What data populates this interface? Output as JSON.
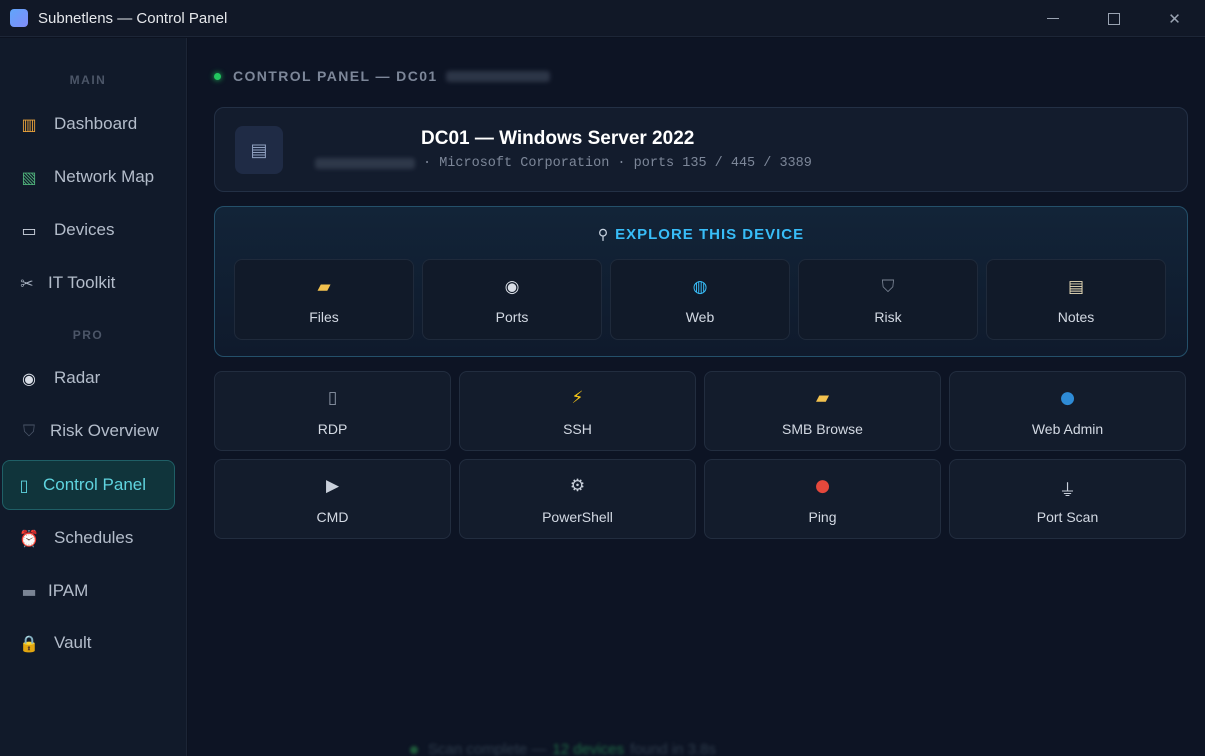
{
  "window": {
    "title": "Subnetlens — Control Panel",
    "controls": {
      "minimize": "minimize",
      "maximize": "maximize",
      "close": "✕"
    }
  },
  "sidebar": {
    "sections": [
      {
        "label": "MAIN"
      },
      {
        "label": "PRO"
      }
    ],
    "items": [
      {
        "label": "Dashboard",
        "icon": "chart-icon",
        "glyph": "▥",
        "color": "#e9a23b"
      },
      {
        "label": "Network Map",
        "icon": "map-icon",
        "glyph": "▧",
        "color": "#4fb07a"
      },
      {
        "label": "Devices",
        "icon": "laptop-icon",
        "glyph": "▭",
        "color": "#cfd6e0"
      },
      {
        "label": "IT Toolkit",
        "icon": "tools-icon",
        "glyph": "✂",
        "color": "#a9b3c2"
      },
      {
        "label": "Radar",
        "icon": "satellite-dish-icon",
        "glyph": "◉",
        "color": "#d9dee6"
      },
      {
        "label": "Risk Overview",
        "icon": "shield-icon",
        "glyph": "⛉",
        "color": "#4a5568"
      },
      {
        "label": "Control Panel",
        "icon": "mobile-icon",
        "glyph": "▯",
        "color": "#5fd4df",
        "active": true
      },
      {
        "label": "Schedules",
        "icon": "alarm-clock-icon",
        "glyph": "⏰",
        "color": "#e25555"
      },
      {
        "label": "IPAM",
        "icon": "server-rack-icon",
        "glyph": "▬",
        "color": "#7a8494"
      },
      {
        "label": "Vault",
        "icon": "lock-icon",
        "glyph": "🔒",
        "color": "#e8b93a"
      }
    ]
  },
  "breadcrumb": {
    "text": "CONTROL PANEL — DC01"
  },
  "device": {
    "title": "DC01 — Windows Server 2022",
    "subtitle": "· Microsoft Corporation · ports 135 / 445 / 3389",
    "icon": "server-icon"
  },
  "explore": {
    "title": "EXPLORE THIS DEVICE",
    "title_icon": "magnifier-icon",
    "tiles": [
      {
        "label": "Files",
        "icon": "folder-icon",
        "glyph": "▰",
        "color": "#f2c14e"
      },
      {
        "label": "Ports",
        "icon": "satellite-dish-icon",
        "glyph": "◉",
        "color": "#d9dee6"
      },
      {
        "label": "Web",
        "icon": "globe-icon",
        "glyph": "◍",
        "color": "#38bdf8"
      },
      {
        "label": "Risk",
        "icon": "shield-icon",
        "glyph": "⛉",
        "color": "#7a8494"
      },
      {
        "label": "Notes",
        "icon": "memo-icon",
        "glyph": "▤",
        "color": "#e8dcb8"
      }
    ]
  },
  "actions": [
    {
      "label": "RDP",
      "icon": "mobile-icon",
      "glyph": "▯",
      "color": "#8c96a6"
    },
    {
      "label": "SSH",
      "icon": "lightning-icon",
      "glyph": "⚡",
      "color": "#f5c518"
    },
    {
      "label": "SMB Browse",
      "icon": "folder-icon",
      "glyph": "▰",
      "color": "#f2c14e"
    },
    {
      "label": "Web Admin",
      "icon": "globe-earth-icon",
      "glyph": "●",
      "color": "#2e8bd6"
    },
    {
      "label": "CMD",
      "icon": "play-icon",
      "glyph": "▶",
      "color": "#c9d0db"
    },
    {
      "label": "PowerShell",
      "icon": "gear-icon",
      "glyph": "⚙",
      "color": "#c9d0db"
    },
    {
      "label": "Ping",
      "icon": "ping-pong-icon",
      "glyph": "●",
      "color": "#e5483c"
    },
    {
      "label": "Port Scan",
      "icon": "plug-icon",
      "glyph": "⏚",
      "color": "#c9d0db"
    }
  ],
  "footer": {
    "text_a": "Scan complete —",
    "highlight": "12 devices",
    "text_b": "found in 3.8s"
  }
}
